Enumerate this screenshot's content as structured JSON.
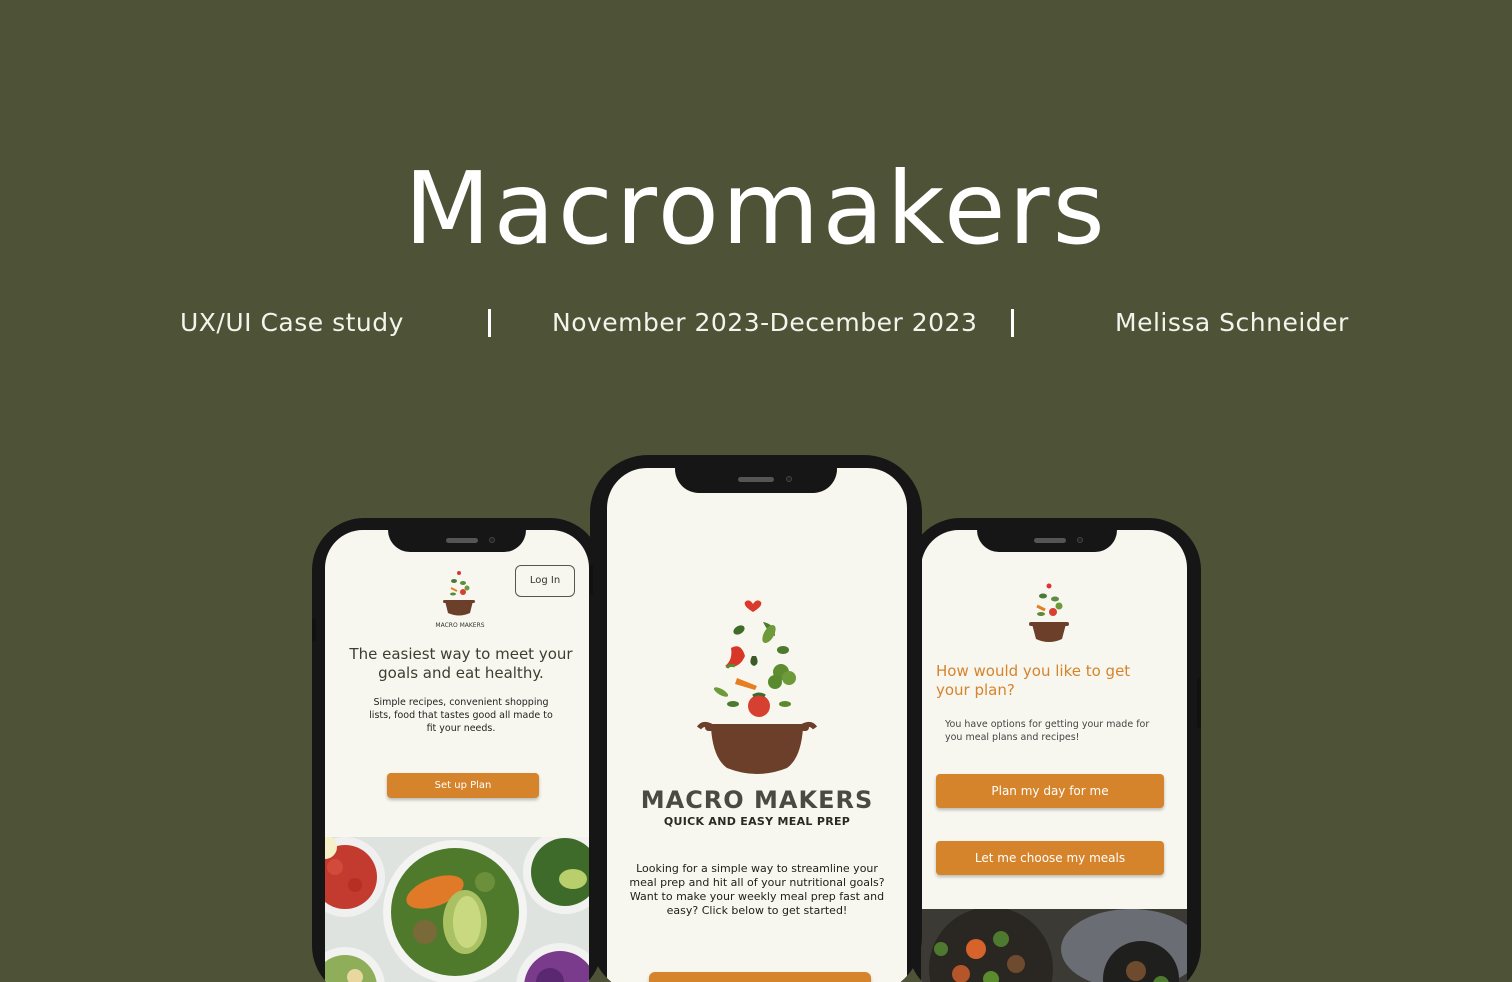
{
  "title": "Macromakers",
  "meta": {
    "type": "UX/UI Case study",
    "dates": "November 2023-December 2023",
    "author": "Melissa Schneider"
  },
  "phone_left": {
    "login_label": "Log In",
    "logo_caption": "MACRO MAKERS",
    "headline": "The easiest way to meet your goals and eat healthy.",
    "subtext": "Simple recipes, convenient shopping lists, food that tastes good all made to fit your needs.",
    "cta": "Set up Plan"
  },
  "phone_center": {
    "brand": "MACRO MAKERS",
    "tagline": "QUICK AND EASY MEAL PREP",
    "body": "Looking for a simple way to streamline your meal prep and hit all of your nutritional goals? Want to make your weekly meal prep fast and easy?  Click below to get started!"
  },
  "phone_right": {
    "question": "How would you like to get your plan?",
    "subtext": "You have options for getting your made for you meal plans and recipes!",
    "option1": "Plan my day for me",
    "option2": "Let me choose my meals"
  },
  "colors": {
    "background": "#4e5337",
    "accent": "#d5842c",
    "screen": "#f8f7ef",
    "pot": "#6b3f2a"
  }
}
